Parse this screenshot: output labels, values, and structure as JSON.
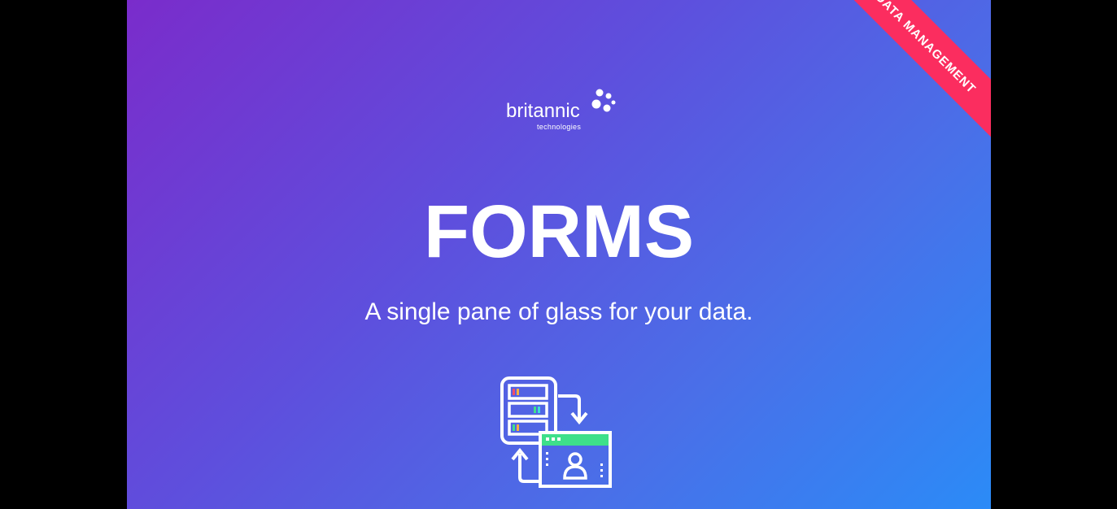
{
  "ribbon": {
    "label": "DATA MANAGEMENT",
    "color": "#fb2d5f"
  },
  "logo": {
    "name": "britannic",
    "tagline": "technologies",
    "icon": "bubbles-icon"
  },
  "hero": {
    "title": "FORMS",
    "subtitle": "A single pane of glass for your data.",
    "icon": "data-transfer-forms-icon"
  },
  "colors": {
    "gradient_start": "#7a2ccb",
    "gradient_end": "#2b8bf7",
    "text": "#ffffff",
    "accent_green": "#3ee08a"
  }
}
